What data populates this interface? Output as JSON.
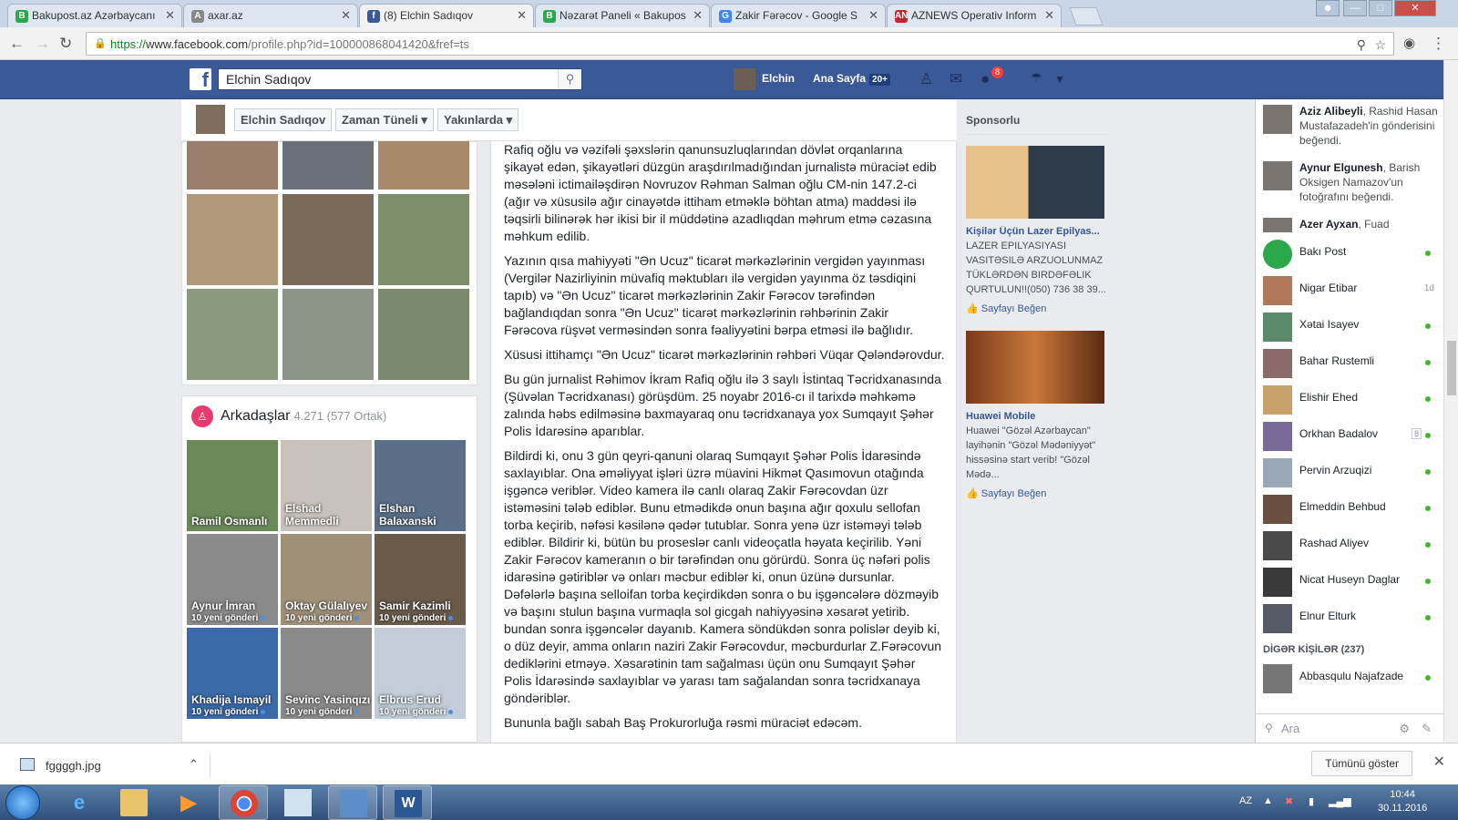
{
  "browser": {
    "tabs": [
      {
        "title": "Bakupost.az Azərbaycanı",
        "icon": "bakupost-icon",
        "color": "#2aa84a",
        "letter": "B"
      },
      {
        "title": "axar.az",
        "icon": "axar-icon",
        "color": "#888888",
        "letter": "A"
      },
      {
        "title": "(8) Elchin Sadıqov",
        "icon": "facebook-icon",
        "color": "#3b5998",
        "letter": "f"
      },
      {
        "title": "Nəzarət Paneli « Bakupos",
        "icon": "bakupost-icon",
        "color": "#2aa84a",
        "letter": "B"
      },
      {
        "title": "Zakir Fərəcov - Google S",
        "icon": "google-icon",
        "color": "#4285f4",
        "letter": "G"
      },
      {
        "title": "AZNEWS Operativ Inform",
        "icon": "aznews-icon",
        "color": "#c0282d",
        "letter": "AN"
      }
    ],
    "active_tab": 2,
    "url_protocol": "https://",
    "url_host": "www.facebook.com",
    "url_rest": "/profile.php?id=100000868041420&fref=ts"
  },
  "fb": {
    "search_value": "Elchin Sadıqov",
    "user_name": "Elchin",
    "home_label": "Ana Sayfa",
    "home_badge": "20+",
    "notif_count": "8"
  },
  "timeline_nav": {
    "name_button": "Elchin Sadıqov",
    "timeline_button": "Zaman Tüneli",
    "recent_button": "Yakınlarda"
  },
  "friends": {
    "title": "Arkadaşlar",
    "count": "4.271 (577 Ortak)",
    "items": [
      {
        "name": "Ramil Osmanlı",
        "sub": ""
      },
      {
        "name": "Elshad Memmedli",
        "sub": ""
      },
      {
        "name": "Elshan Balaxanski",
        "sub": ""
      },
      {
        "name": "Aynur İmran",
        "sub": "10 yeni gönderi"
      },
      {
        "name": "Oktay Gülalıyev",
        "sub": "10 yeni gönderi"
      },
      {
        "name": "Samir Kazimli",
        "sub": "10 yeni gönderi"
      },
      {
        "name": "Khadija Ismayil",
        "sub": "10 yeni gönderi"
      },
      {
        "name": "Sevinc Yasinqızı",
        "sub": "10 yeni gönderi"
      },
      {
        "name": "Elbrus Erud",
        "sub": "10 yeni gönderi"
      }
    ]
  },
  "post": {
    "paragraphs": [
      "Rafiq oğlu və vəzifəli şəxslərin qanunsuzluqlarından dövlət orqanlarına şikayət edən, şikayətləri düzgün araşdırılmadığından jurnalistə müraciət edib məsələni ictimailəşdirən Novruzov Rəhman Salman oğlu CM-nin 147.2-ci (ağır və xüsusilə ağır cinayətdə ittiham etməklə böhtan atma) maddəsi ilə təqsirli bilinərək hər ikisi bir il müddətinə azadlıqdan məhrum etmə cəzasına məhkum edilib.",
      "Yazının qısa mahiyyəti \"Ən Ucuz\" ticarət mərkəzlərinin vergidən yayınması (Vergilər Nazirliyinin müvafiq məktubları ilə vergidən yayınma öz təsdiqini tapıb) və \"Ən Ucuz\" ticarət mərkəzlərinin Zakir Fərəcov tərəfindən bağlandıqdan sonra \"Ən Ucuz\" ticarət mərkəzlərinin rəhbərinin Zakir Fərəcova rüşvət verməsindən sonra fəaliyyətini bərpa etməsi ilə bağlıdır.",
      "Xüsusi ittihamçı \"Ən Ucuz\" ticarət mərkəzlərinin rəhbəri Vüqar Qələndərovdur.",
      "Bu gün jurnalist Rəhimov İkram Rafiq oğlu ilə 3 saylı İstintaq Təcridxanasında (Şüvəlan Təcridxanası) görüşdüm. 25 noyabr 2016-cı il tarixdə məhkəmə zalında həbs edilməsinə baxmayaraq onu təcridxanaya yox Sumqayıt Şəhər Polis İdarəsinə aparıblar.",
      "Bildirdi ki, onu 3 gün qeyri-qanuni olaraq Sumqayıt Şəhər Polis İdarəsində saxlayıblar. Ona əməliyyat işləri üzrə müavini Hikmət Qasımovun otağında işgəncə veriblər. Video kamera ilə canlı olaraq Zakir Fərəcovdan üzr istəməsini tələb ediblər. Bunu etmədikdə onun başına ağır qoxulu sellofan torba keçirib, nəfəsi kəsilənə qədər tutublar. Sonra yenə üzr istəməyi tələb ediblər. Bildirir ki, bütün bu proseslər canlı videoçatla həyata keçirilib. Yəni Zakir Fərəcov kameranın o bir tərəfindən onu görürdü. Sonra üç nəfəri polis idarəsinə gətiriblər və onları məcbur ediblər ki, onun üzünə dursunlar. Dəfələrlə başına selloifan torba keçirdikdən sonra o bu işgəncələrə dözməyib və başını stulun başına vurmaqla sol gicgah nahiyyəsinə xəsarət yetirib. bundan sonra işgəncələr dayanıb. Kamera söndükdən sonra polislər deyib ki, o düz deyir, amma onların naziri Zakir Fərəcovdur, məcburdurlar Z.Fərəcovun dediklərini etməyə. Xəsarətinin tam sağalması üçün onu Sumqayıt Şəhər Polis İdarəsində saxlayıblar və yarası tam sağalandan sonra təcridxanaya göndəriblər.",
      "Bununla bağlı sabah Baş Prokurorluğa rəsmi müraciət edəcəm."
    ]
  },
  "ads": {
    "heading": "Sponsorlu",
    "items": [
      {
        "title": "Kişilər Üçün Lazer Epilyas...",
        "body": "LAZER EPILYASIYASI VASITƏSILƏ ARZUOLUNMAZ TÜKLƏRDƏN BIRDƏFƏLIK QURTULUN!!(050) 736 38 39...",
        "like": "Sayfayı Beğen"
      },
      {
        "title": "Huawei Mobile",
        "body": "Huawei \"Gözəl Azərbaycan\" layihənin \"Gözəl Mədəniyyət\" hissəsinə start verib! \"Gözəl Mədə...",
        "like": "Sayfayı Beğen"
      }
    ]
  },
  "chat": {
    "activity": [
      {
        "name": "Aziz Alibeyli",
        "text": ", Rashid Hasan Mustafazadeh'in gönderisini beğendi."
      },
      {
        "name": "Aynur Elgunesh",
        "text": ", Barish Oksigen Namazov'un fotoğrafını beğendi."
      },
      {
        "name": "Azer Ayxan",
        "text": ", Fuad"
      }
    ],
    "contacts": [
      {
        "name": "Bakı Post",
        "status": "online",
        "color": "#2aa84a"
      },
      {
        "name": "Nigar Etibar",
        "status": "1d",
        "color": "#b07a5a"
      },
      {
        "name": "Xətai Isayev",
        "status": "online",
        "color": "#5a8a6a"
      },
      {
        "name": "Bahar Rustemli",
        "status": "online",
        "color": "#8a6a6a"
      },
      {
        "name": "Elishir Ehed",
        "status": "online",
        "color": "#c9a06a"
      },
      {
        "name": "Orkhan Badalov",
        "status": "online",
        "count": "8",
        "color": "#7a6a9a"
      },
      {
        "name": "Pervin Arzuqizi",
        "status": "online",
        "color": "#9aa7b8"
      },
      {
        "name": "Elmeddin Behbud",
        "status": "online",
        "color": "#6a5040"
      },
      {
        "name": "Rashad Aliyev",
        "status": "online",
        "color": "#4a4a4a"
      },
      {
        "name": "Nicat Huseyn Daglar",
        "status": "online",
        "color": "#3a3a3a"
      },
      {
        "name": "Elnur Elturk",
        "status": "online",
        "color": "#555a66"
      }
    ],
    "others_label": "DİGƏR KİŞİLƏR (237)",
    "others": [
      {
        "name": "Abbasqulu Najafzade",
        "status": "online",
        "color": "#777"
      }
    ],
    "search_placeholder": "Ara"
  },
  "downloads": {
    "file": "fggggh.jpg",
    "show_all": "Tümünü göster"
  },
  "taskbar": {
    "lang": "AZ",
    "time": "10:44",
    "date": "30.11.2016"
  }
}
